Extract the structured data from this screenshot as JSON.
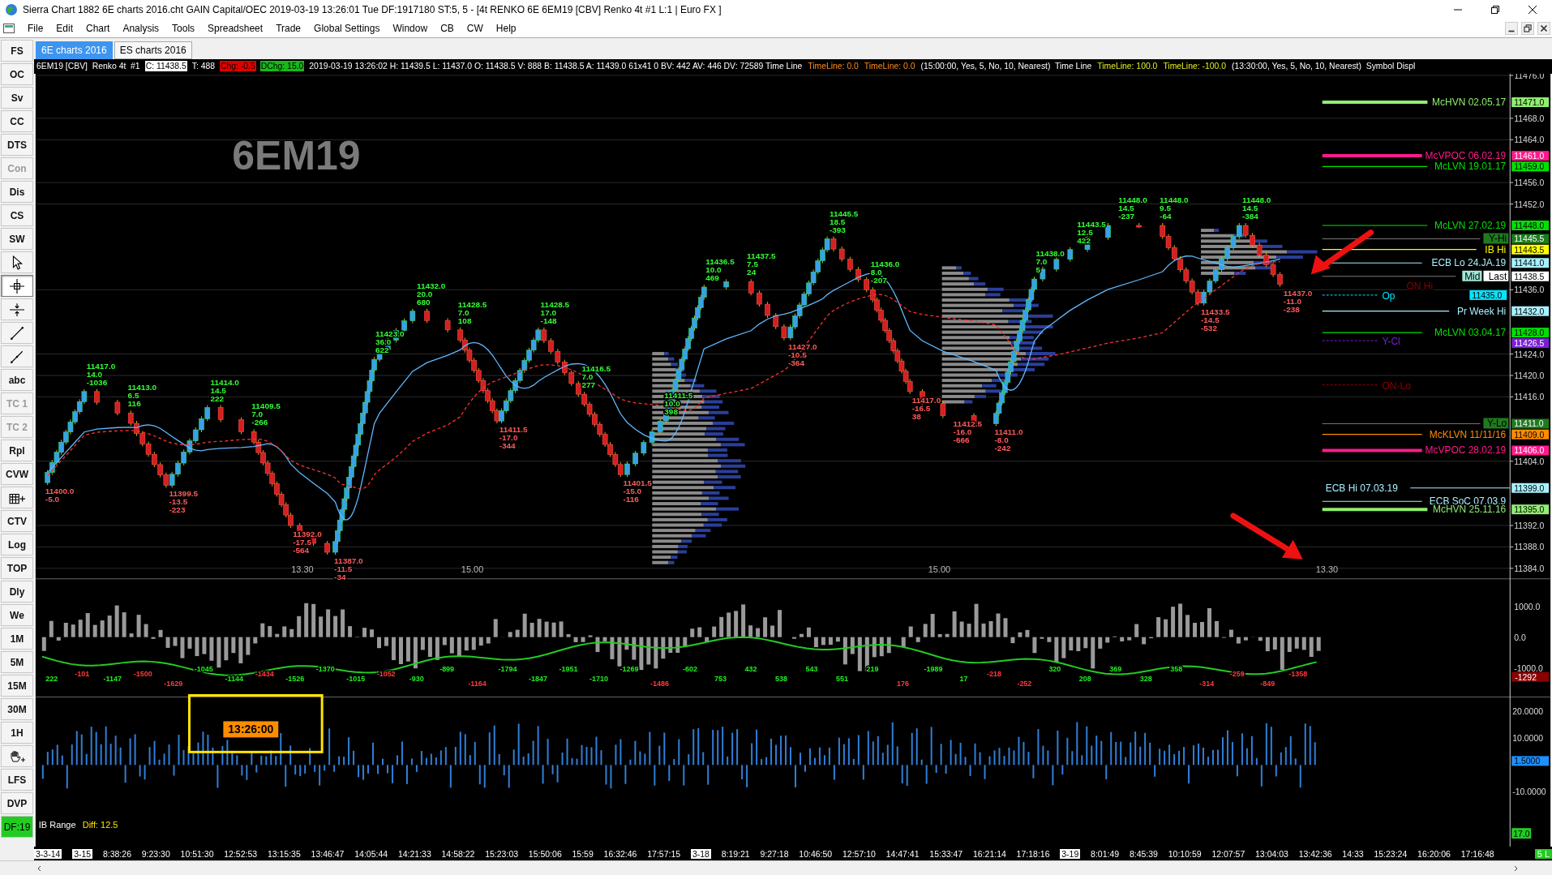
{
  "window": {
    "title": "Sierra Chart 1882 6E charts 2016.cht  GAIN Capital/OEC 2019-03-19  13:26:01 Tue  DF:1917180  ST:5, 5 - [4t RENKO 6E  6EM19 [CBV]  Renko 4t  #1  L:1 | Euro FX ]"
  },
  "menu": [
    "File",
    "Edit",
    "Chart",
    "Analysis",
    "Tools",
    "Spreadsheet",
    "Trade",
    "Global Settings",
    "Window",
    "CB",
    "CW",
    "Help"
  ],
  "tabs": [
    {
      "label": "6E charts 2016",
      "selected": true
    },
    {
      "label": "ES charts 2016",
      "selected": false
    }
  ],
  "toolbar": [
    {
      "label": "FS",
      "kind": "text",
      "disabled": false,
      "selected": false
    },
    {
      "label": "OC",
      "kind": "text",
      "disabled": false,
      "selected": false
    },
    {
      "label": "Sv",
      "kind": "text",
      "disabled": false,
      "selected": false
    },
    {
      "label": "CC",
      "kind": "text",
      "disabled": false,
      "selected": false
    },
    {
      "label": "DTS",
      "kind": "text",
      "disabled": false,
      "selected": false
    },
    {
      "label": "Con",
      "kind": "text",
      "disabled": true,
      "selected": false
    },
    {
      "label": "Dis",
      "kind": "text",
      "disabled": false,
      "selected": false
    },
    {
      "label": "CS",
      "kind": "text",
      "disabled": false,
      "selected": false
    },
    {
      "label": "SW",
      "kind": "text",
      "disabled": false,
      "selected": false
    },
    {
      "kind": "pointer",
      "selected": false
    },
    {
      "kind": "crosshair",
      "selected": true
    },
    {
      "kind": "split",
      "selected": false
    },
    {
      "kind": "line",
      "selected": false
    },
    {
      "kind": "segment",
      "selected": false
    },
    {
      "label": "abc",
      "kind": "text",
      "disabled": false,
      "selected": false
    },
    {
      "label": "TC 1",
      "kind": "text",
      "disabled": true,
      "selected": false
    },
    {
      "label": "TC 2",
      "kind": "text",
      "disabled": true,
      "selected": false
    },
    {
      "label": "Rpl",
      "kind": "text",
      "disabled": false,
      "selected": false
    },
    {
      "label": "CVW",
      "kind": "text",
      "disabled": false,
      "selected": false
    },
    {
      "kind": "table",
      "selected": false
    },
    {
      "label": "CTV",
      "kind": "text",
      "disabled": false,
      "selected": false
    },
    {
      "label": "Log",
      "kind": "text",
      "disabled": false,
      "selected": false
    },
    {
      "label": "TOP",
      "kind": "text",
      "disabled": false,
      "selected": false
    },
    {
      "label": "Dly",
      "kind": "text",
      "disabled": false,
      "selected": false
    },
    {
      "label": "We",
      "kind": "text",
      "disabled": false,
      "selected": false
    },
    {
      "label": "1M",
      "kind": "text",
      "disabled": false,
      "selected": false
    },
    {
      "label": "5M",
      "kind": "text",
      "disabled": false,
      "selected": false
    },
    {
      "label": "15M",
      "kind": "text",
      "disabled": false,
      "selected": false
    },
    {
      "label": "30M",
      "kind": "text",
      "disabled": false,
      "selected": false
    },
    {
      "label": "1H",
      "kind": "text",
      "disabled": false,
      "selected": false
    },
    {
      "kind": "hand",
      "selected": false
    },
    {
      "label": "LFS",
      "kind": "text",
      "disabled": false,
      "selected": false
    },
    {
      "label": "DVP",
      "kind": "text",
      "disabled": false,
      "selected": false
    },
    {
      "label": "DF:19",
      "kind": "status",
      "selected": false
    }
  ],
  "header": [
    {
      "text": "6EM19 [CBV]  Renko 4t  #1",
      "kind": "plain"
    },
    {
      "text": "C: 11438.5",
      "kind": "boxed"
    },
    {
      "text": "T: 488",
      "kind": "plain"
    },
    {
      "text": "Chg: -0.5",
      "kind": "down"
    },
    {
      "text": "DChg: 15.0",
      "kind": "up"
    },
    {
      "text": "2019-03-19 13:26:02 H: 11439.5 L: 11437.0 O: 11438.5 V: 888 B: 11438.5 A: 11439.0 61x41 0 BV: 442 AV: 446 DV: 72589 Time Line",
      "kind": "plain"
    },
    {
      "text": "TimeLine: 0.0",
      "kind": "orange"
    },
    {
      "text": "TimeLine: 0.0",
      "kind": "orange"
    },
    {
      "text": "(15:00:00, Yes, 5, No, 10, Nearest)  Time Line",
      "kind": "plain"
    },
    {
      "text": "TimeLine: 100.0",
      "kind": "yellow"
    },
    {
      "text": "TimeLine: -100.0",
      "kind": "yellow"
    },
    {
      "text": "(13:30:00, Yes, 5, No, 10, Nearest)  Symbol Displ",
      "kind": "plain"
    }
  ],
  "price_pane": {
    "symbol": "6EM19",
    "ticks": [
      "11476.0",
      "11468.0",
      "11464.0",
      "11456.0",
      "11452.0",
      "11436.0",
      "11424.0",
      "11420.0",
      "11416.0",
      "11404.0",
      "11392.0",
      "11388.0",
      "11384.0"
    ],
    "session_marks": [
      "13.30",
      "15.00",
      "15.00",
      "13.30"
    ],
    "levels": [
      {
        "label": "McHVN 02.05.17",
        "kind": "thick",
        "color": "#90ee70",
        "axis_label": "11471.0"
      },
      {
        "label": "McVPOC 06.02.19",
        "kind": "thick",
        "color": "#ff1a8c",
        "axis_label": "11461.0"
      },
      {
        "label": "McLVN 19.01.17",
        "kind": "line",
        "color": "#00e000",
        "axis_label": "11459.0"
      },
      {
        "label": "McLVN 27.02.19",
        "kind": "line",
        "color": "#00e000",
        "axis_label": "11448.0"
      },
      {
        "label": "Y-Hi",
        "kind": "tag",
        "color": "#1f7a1f",
        "axis_label": "11445.5"
      },
      {
        "label": "IB Hi",
        "kind": "line",
        "color": "#ffff00",
        "axis_label": "11443.5"
      },
      {
        "label": "ECB Lo 24.JA.19",
        "kind": "line",
        "color": "#a8f0ff",
        "axis_label": "11441.0"
      },
      {
        "label": "Last",
        "kind": "tag",
        "color": "#ffffff",
        "axis_label": "11438.5",
        "note": {
          "label": "Mid",
          "color": "#a0e8d8"
        }
      },
      {
        "label": "Op",
        "kind": "dashed",
        "color": "#00e5ff",
        "axis_label": "11435.0",
        "note": {
          "label": "ON Hi",
          "color": "#8b0000"
        }
      },
      {
        "label": "Pr Week Hi",
        "kind": "line",
        "color": "#a8f0ff",
        "axis_label": "11432.0"
      },
      {
        "label": "McLVN  03.04.17",
        "kind": "line",
        "color": "#00e000",
        "axis_label": "11428.0"
      },
      {
        "label": "Y-Cl",
        "kind": "dashed",
        "color": "#7a1fd6",
        "axis_label": "11426.5"
      },
      {
        "label": "ON-Lo",
        "kind": "dashed",
        "color": "#8b0000"
      },
      {
        "label": "Y-Lo",
        "kind": "tag",
        "color": "#1f7a1f",
        "axis_label": "11411.0"
      },
      {
        "label": "McKLVN 11/11/16",
        "kind": "line",
        "color": "#ff8c00",
        "axis_label": "11409.0"
      },
      {
        "label": "McVPOC 28.02.19",
        "kind": "thick",
        "color": "#ff1a8c",
        "axis_label": "11406.0"
      },
      {
        "label": "ECB Hi 07.03.19",
        "kind": "span",
        "color": "#a8f0ff",
        "axis_label": "11399.0"
      },
      {
        "label": "ECB SoC 07.03.9",
        "kind": "line",
        "color": "#a8f0ff"
      },
      {
        "label": "McHVN 25.11.16",
        "kind": "thick",
        "color": "#90ee70",
        "axis_label": "11395.0"
      }
    ],
    "swings": [
      {
        "kind": "low",
        "lines": [
          "11400.0",
          "-5.0"
        ]
      },
      {
        "kind": "high",
        "lines": [
          "11417.0",
          "14.0",
          "-1036"
        ]
      },
      {
        "kind": "high",
        "lines": [
          "11413.0",
          "6.5",
          "116"
        ]
      },
      {
        "kind": "low",
        "lines": [
          "11399.5",
          "-13.5",
          "-223"
        ]
      },
      {
        "kind": "high",
        "lines": [
          "11414.0",
          "14.5",
          "222"
        ]
      },
      {
        "kind": "high",
        "lines": [
          "11409.5",
          "7.0",
          "-266"
        ]
      },
      {
        "kind": "low",
        "lines": [
          "11392.0",
          "-17.5",
          "-564"
        ]
      },
      {
        "kind": "low",
        "lines": [
          "11387.0",
          "-11.5",
          "-34"
        ]
      },
      {
        "kind": "high",
        "lines": [
          "11423.0",
          "36.0",
          "622"
        ]
      },
      {
        "kind": "high",
        "lines": [
          "11432.0",
          "20.0",
          "680"
        ]
      },
      {
        "kind": "high",
        "lines": [
          "11428.5",
          "7.0",
          "108"
        ]
      },
      {
        "kind": "low",
        "lines": [
          "11411.5",
          "-17.0",
          "-344"
        ]
      },
      {
        "kind": "high",
        "lines": [
          "11428.5",
          "17.0",
          "-148"
        ]
      },
      {
        "kind": "high",
        "lines": [
          "11416.5",
          "7.0",
          "277"
        ]
      },
      {
        "kind": "low",
        "lines": [
          "11401.5",
          "-15.0",
          "-116"
        ]
      },
      {
        "kind": "high",
        "lines": [
          "11411.5",
          "10.0",
          "398"
        ]
      },
      {
        "kind": "high",
        "lines": [
          "11436.5",
          "10.0",
          "469"
        ]
      },
      {
        "kind": "high",
        "lines": [
          "11437.5",
          "7.5",
          "24"
        ]
      },
      {
        "kind": "low",
        "lines": [
          "11427.0",
          "-10.5",
          "-364"
        ]
      },
      {
        "kind": "high",
        "lines": [
          "11445.5",
          "18.5",
          "-393"
        ]
      },
      {
        "kind": "high",
        "lines": [
          "11436.0",
          "8.0",
          "-207"
        ]
      },
      {
        "kind": "low",
        "lines": [
          "11417.0",
          "-16.5",
          "38"
        ]
      },
      {
        "kind": "low",
        "lines": [
          "11412.5",
          "-16.0",
          "-666"
        ]
      },
      {
        "kind": "low",
        "lines": [
          "11411.0",
          "-8.0",
          "-242"
        ]
      },
      {
        "kind": "high",
        "lines": [
          "11438.0",
          "7.0",
          "5"
        ]
      },
      {
        "kind": "high",
        "lines": [
          "11443.5",
          "12.5",
          "422"
        ]
      },
      {
        "kind": "high",
        "lines": [
          "11448.0",
          "14.5",
          "-237"
        ]
      },
      {
        "kind": "high",
        "lines": [
          "11448.0",
          "9.5",
          "-64"
        ]
      },
      {
        "kind": "low",
        "lines": [
          "11433.5",
          "-14.5",
          "-532"
        ]
      },
      {
        "kind": "high",
        "lines": [
          "11448.0",
          "14.5",
          "-384"
        ]
      },
      {
        "kind": "low",
        "lines": [
          "11437.0",
          "-11.0",
          "-238"
        ]
      }
    ]
  },
  "delta_pane": {
    "ticks": [
      "1000.0",
      "0.0",
      "-1000.0"
    ],
    "value_box": {
      "text": "-1292",
      "color": "#8b0000"
    },
    "labels": [
      {
        "text": "222",
        "kind": "up"
      },
      {
        "text": "-101",
        "kind": "down"
      },
      {
        "text": "-1147",
        "kind": "up"
      },
      {
        "text": "-1500",
        "kind": "down"
      },
      {
        "text": "-1629",
        "kind": "down"
      },
      {
        "text": "-1045",
        "kind": "up"
      },
      {
        "text": "-1144",
        "kind": "up"
      },
      {
        "text": "-1434",
        "kind": "down"
      },
      {
        "text": "-1526",
        "kind": "up"
      },
      {
        "text": "-1370",
        "kind": "up"
      },
      {
        "text": "-1015",
        "kind": "up"
      },
      {
        "text": "-1052",
        "kind": "down"
      },
      {
        "text": "-930",
        "kind": "up"
      },
      {
        "text": "-899",
        "kind": "up"
      },
      {
        "text": "-1164",
        "kind": "down"
      },
      {
        "text": "-1794",
        "kind": "up"
      },
      {
        "text": "-1847",
        "kind": "up"
      },
      {
        "text": "-1951",
        "kind": "up"
      },
      {
        "text": "-1710",
        "kind": "up"
      },
      {
        "text": "-1269",
        "kind": "up"
      },
      {
        "text": "-1486",
        "kind": "down"
      },
      {
        "text": "-602",
        "kind": "up"
      },
      {
        "text": "753",
        "kind": "up"
      },
      {
        "text": "432",
        "kind": "up"
      },
      {
        "text": "538",
        "kind": "up"
      },
      {
        "text": "543",
        "kind": "up"
      },
      {
        "text": "551",
        "kind": "up"
      },
      {
        "text": "219",
        "kind": "up"
      },
      {
        "text": "176",
        "kind": "down"
      },
      {
        "text": "-1989",
        "kind": "up"
      },
      {
        "text": "17",
        "kind": "up"
      },
      {
        "text": "-218",
        "kind": "down"
      },
      {
        "text": "-252",
        "kind": "down"
      },
      {
        "text": "320",
        "kind": "up"
      },
      {
        "text": "208",
        "kind": "up"
      },
      {
        "text": "369",
        "kind": "up"
      },
      {
        "text": "328",
        "kind": "up"
      },
      {
        "text": "358",
        "kind": "up"
      },
      {
        "text": "-314",
        "kind": "down"
      },
      {
        "text": "-259",
        "kind": "down"
      },
      {
        "text": "-849",
        "kind": "down"
      },
      {
        "text": "-1358",
        "kind": "down"
      }
    ]
  },
  "volume_pane": {
    "ticks": [
      "20.0000",
      "10.0000",
      "-10.0000"
    ],
    "value_box": {
      "text": "1.5000",
      "color": "#1e90ff"
    },
    "cursor_time": "13:26:00",
    "ib_label": "IB Range",
    "ib_diff": "Diff: 12.5",
    "ib_box": "17.0"
  },
  "time_axis": [
    {
      "text": "3-3-14",
      "kind": "date"
    },
    {
      "text": "3-15",
      "kind": "date"
    },
    {
      "text": "8:38:26",
      "kind": "time"
    },
    {
      "text": "9:23:30",
      "kind": "time"
    },
    {
      "text": "10:51:30",
      "kind": "time"
    },
    {
      "text": "12:52:53",
      "kind": "time"
    },
    {
      "text": "13:15:35",
      "kind": "time"
    },
    {
      "text": "13:46:47",
      "kind": "time"
    },
    {
      "text": "14:05:44",
      "kind": "time"
    },
    {
      "text": "14:21:33",
      "kind": "time"
    },
    {
      "text": "14:58:22",
      "kind": "time"
    },
    {
      "text": "15:23:03",
      "kind": "time"
    },
    {
      "text": "15:50:06",
      "kind": "time"
    },
    {
      "text": "15:59",
      "kind": "time"
    },
    {
      "text": "16:32:46",
      "kind": "time"
    },
    {
      "text": "17:57:15",
      "kind": "time"
    },
    {
      "text": "3-18",
      "kind": "date"
    },
    {
      "text": "8:19:21",
      "kind": "time"
    },
    {
      "text": "9:27:18",
      "kind": "time"
    },
    {
      "text": "10:46:50",
      "kind": "time"
    },
    {
      "text": "12:57:10",
      "kind": "time"
    },
    {
      "text": "14:47:41",
      "kind": "time"
    },
    {
      "text": "15:33:47",
      "kind": "time"
    },
    {
      "text": "16:21:14",
      "kind": "time"
    },
    {
      "text": "17:18:16",
      "kind": "time"
    },
    {
      "text": "3-19",
      "kind": "date"
    },
    {
      "text": "8:01:49",
      "kind": "time"
    },
    {
      "text": "8:45:39",
      "kind": "time"
    },
    {
      "text": "10:10:59",
      "kind": "time"
    },
    {
      "text": "12:07:57",
      "kind": "time"
    },
    {
      "text": "13:04:03",
      "kind": "time"
    },
    {
      "text": "13:42:36",
      "kind": "time"
    },
    {
      "text": "14:33",
      "kind": "time"
    },
    {
      "text": "15:23:24",
      "kind": "time"
    },
    {
      "text": "16:20:06",
      "kind": "time"
    },
    {
      "text": "17:16:48",
      "kind": "time"
    }
  ],
  "axis_corner": "5 L"
}
